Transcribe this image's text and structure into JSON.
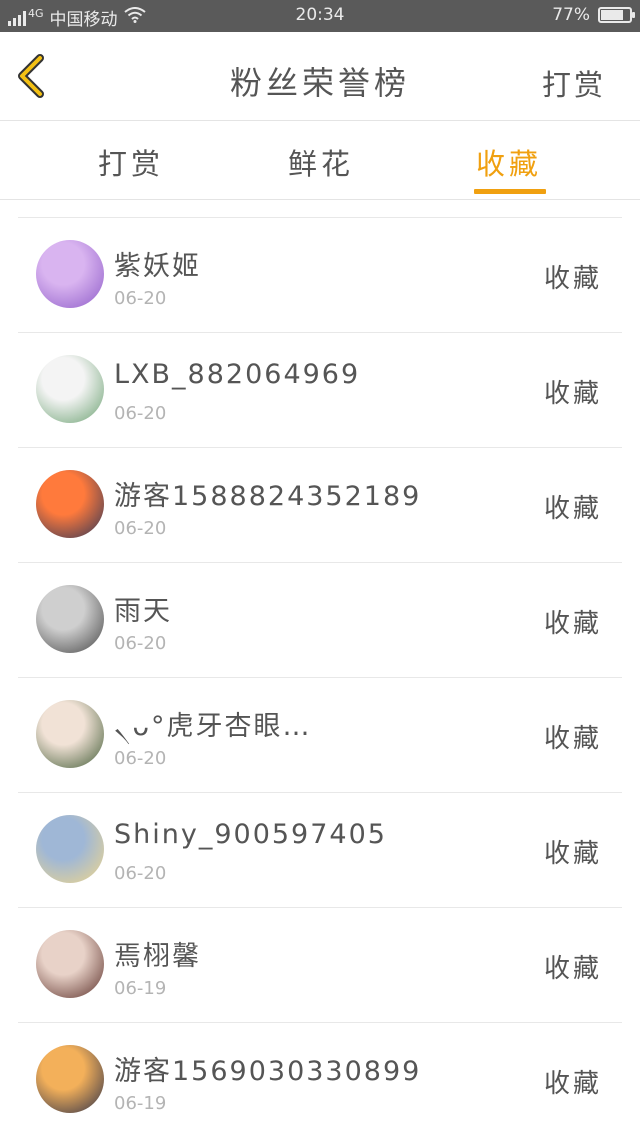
{
  "status_bar": {
    "network": "4G",
    "carrier": "中国移动",
    "time": "20:34",
    "battery": "77%",
    "battery_level": 0.77
  },
  "navbar": {
    "title": "粉丝荣誉榜",
    "action_label": "打赏",
    "back_icon": "chevron-left-icon",
    "accent_color": "#f0a010"
  },
  "tabs": [
    {
      "label": "打赏",
      "active": false
    },
    {
      "label": "鲜花",
      "active": false
    },
    {
      "label": "收藏",
      "active": true
    }
  ],
  "fans": [
    {
      "name": "紫妖姬",
      "date": "06-20",
      "action": "收藏",
      "avatar_colors": [
        "#d9b4f0",
        "#8e5cc8"
      ]
    },
    {
      "name": "LXB_882064969",
      "date": "06-20",
      "action": "收藏",
      "avatar_colors": [
        "#f4f4f4",
        "#6aa070"
      ]
    },
    {
      "name": "游客15888243521​89",
      "date": "06-20",
      "action": "收藏",
      "avatar_colors": [
        "#ff7a3c",
        "#2b3458"
      ]
    },
    {
      "name": "雨天",
      "date": "06-20",
      "action": "收藏",
      "avatar_colors": [
        "#cfcfcf",
        "#444444"
      ]
    },
    {
      "name": "৲ᴗ°虎牙杏眼…",
      "date": "06-20",
      "action": "收藏",
      "avatar_colors": [
        "#f1e2d6",
        "#3f5a34"
      ]
    },
    {
      "name": "Shiny_900597405",
      "date": "06-20",
      "action": "收藏",
      "avatar_colors": [
        "#9fb7d6",
        "#f1d78a"
      ]
    },
    {
      "name": "焉栩馨",
      "date": "06-19",
      "action": "收藏",
      "avatar_colors": [
        "#e8d2c8",
        "#5a2e28"
      ]
    },
    {
      "name": "游客15690303308​99",
      "date": "06-19",
      "action": "收藏",
      "avatar_colors": [
        "#f3b05a",
        "#2a2e48"
      ]
    }
  ]
}
